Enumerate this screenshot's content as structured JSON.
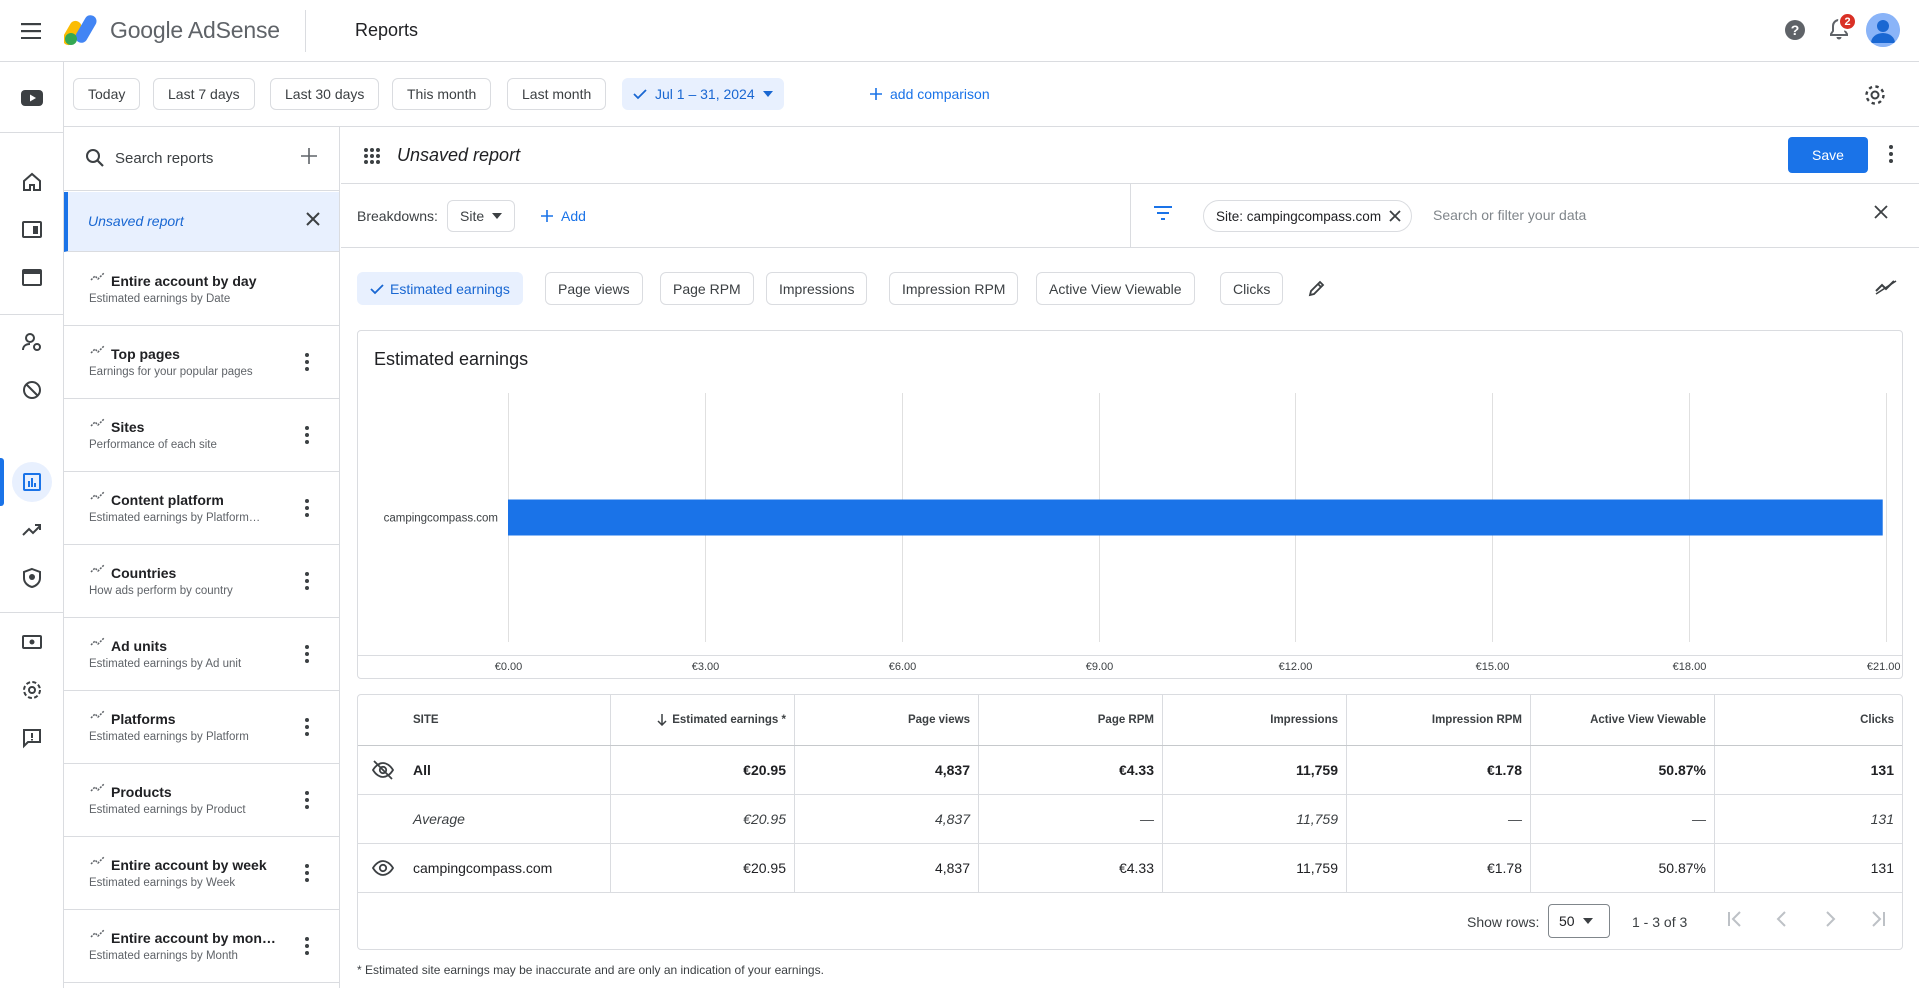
{
  "app": {
    "brand": "Google AdSense",
    "page_title": "Reports",
    "notifications_count": "2"
  },
  "date_filters": {
    "chips": [
      "Today",
      "Last 7 days",
      "Last 30 days",
      "This month",
      "Last month"
    ],
    "selected_range": "Jul 1 – 31, 2024",
    "add_comparison": "add comparison"
  },
  "reports_panel": {
    "search_placeholder": "Search reports",
    "unsaved_label": "Unsaved report",
    "items": [
      {
        "title": "Entire account by day",
        "subtitle": "Estimated earnings by Date"
      },
      {
        "title": "Top pages",
        "subtitle": "Earnings for your popular pages"
      },
      {
        "title": "Sites",
        "subtitle": "Performance of each site"
      },
      {
        "title": "Content platform",
        "subtitle": "Estimated earnings by Platform…"
      },
      {
        "title": "Countries",
        "subtitle": "How ads perform by country"
      },
      {
        "title": "Ad units",
        "subtitle": "Estimated earnings by Ad unit"
      },
      {
        "title": "Platforms",
        "subtitle": "Estimated earnings by Platform"
      },
      {
        "title": "Products",
        "subtitle": "Estimated earnings by Product"
      },
      {
        "title": "Entire account by week",
        "subtitle": "Estimated earnings by Week"
      },
      {
        "title": "Entire account by mon…",
        "subtitle": "Estimated earnings by Month"
      }
    ]
  },
  "report": {
    "name": "Unsaved report",
    "save_label": "Save",
    "breakdowns_label": "Breakdowns:",
    "breakdown_value": "Site",
    "add_label": "Add",
    "filter_chip": "Site: campingcompass.com",
    "filter_placeholder": "Search or filter your data"
  },
  "metrics": [
    "Estimated earnings",
    "Page views",
    "Page RPM",
    "Impressions",
    "Impression RPM",
    "Active View Viewable",
    "Clicks"
  ],
  "chart_data": {
    "type": "bar",
    "orientation": "horizontal",
    "title": "Estimated earnings",
    "categories": [
      "campingcompass.com"
    ],
    "values": [
      20.95
    ],
    "xlim": [
      0,
      21
    ],
    "x_ticks": [
      "€0.00",
      "€3.00",
      "€6.00",
      "€9.00",
      "€12.00",
      "€15.00",
      "€18.00",
      "€21.00"
    ],
    "color": "#1a73e8",
    "grid": true
  },
  "table": {
    "headers": [
      "SITE",
      "Estimated earnings *",
      "Page views",
      "Page RPM",
      "Impressions",
      "Impression RPM",
      "Active View Viewable",
      "Clicks"
    ],
    "rows": [
      [
        "All",
        "€20.95",
        "4,837",
        "€4.33",
        "11,759",
        "€1.78",
        "50.87%",
        "131"
      ],
      [
        "Average",
        "€20.95",
        "4,837",
        "—",
        "11,759",
        "—",
        "—",
        "131"
      ],
      [
        "campingcompass.com",
        "€20.95",
        "4,837",
        "€4.33",
        "11,759",
        "€1.78",
        "50.87%",
        "131"
      ]
    ],
    "show_rows_label": "Show rows:",
    "rows_per_page": "50",
    "range": "1 - 3 of 3"
  },
  "footnote": "* Estimated site earnings may be inaccurate and are only an indication of your earnings.",
  "colors": {
    "accent": "#1a73e8",
    "selected_bg": "#e8f0fe",
    "badge": "#d93025"
  }
}
